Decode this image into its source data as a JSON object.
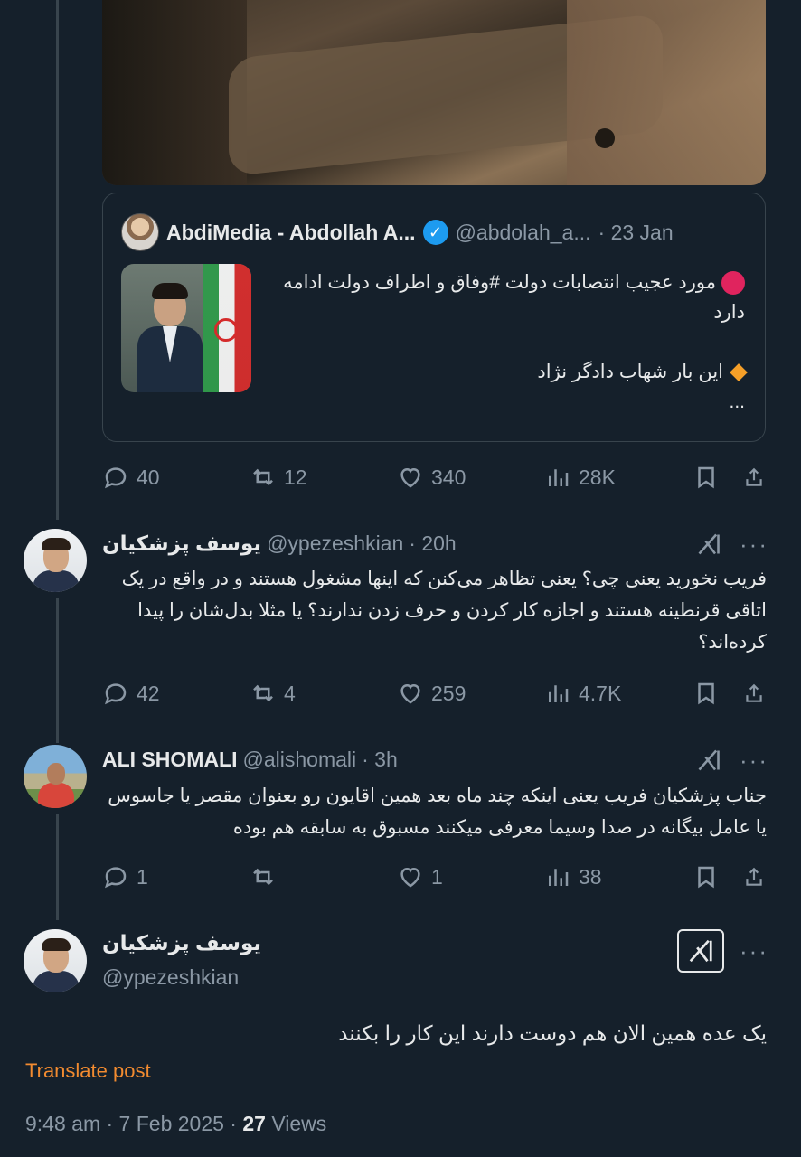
{
  "quoted_post": {
    "author_name": "AbdiMedia - Abdollah A...",
    "author_handle": "@abdolah_a...",
    "date": "· 23 Jan",
    "line1": "مورد عجیب انتصابات دولت #وفاق و اطراف دولت ادامه دارد",
    "line2": "این بار شهاب دادگر نژاد",
    "ellipsis": "..."
  },
  "original_post_stats": {
    "replies": "40",
    "reposts": "12",
    "likes": "340",
    "views": "28K"
  },
  "replies": [
    {
      "author_name": "یوسف پزشکیان",
      "author_handle": "@ypezeshkian",
      "time": "· 20h",
      "text": "فریب نخورید یعنی چی؟ یعنی تظاهر می‌کنن که اینها مشغول هستند و در واقع در یک اتاقی قرنطینه هستند و اجازه کار کردن و حرف زدن ندارند؟ یا مثلا بدل‌شان را پیدا کرده‌اند؟",
      "stats": {
        "replies": "42",
        "reposts": "4",
        "likes": "259",
        "views": "4.7K"
      }
    },
    {
      "author_name": "ALI SHOMALI",
      "author_handle": "@alishomali",
      "time": "· 3h",
      "text": "جناب پزشکیان فریب یعنی اینکه چند ماه بعد همین اقایون رو بعنوان مقصر یا جاسوس یا عامل بیگانه در صدا وسیما معرفی میکنند  مسبوق به سابقه هم بوده",
      "stats": {
        "replies": "1",
        "reposts": "",
        "likes": "1",
        "views": "38"
      }
    }
  ],
  "main_post": {
    "author_name": "یوسف پزشکیان",
    "author_handle": "@ypezeshkian",
    "text": "یک عده همین الان هم دوست دارند این کار را بکنند",
    "translate_label": "Translate post",
    "timestamp": "9:48 am · 7 Feb 2025 · ",
    "views_count": "27",
    "views_label": " Views"
  },
  "icons": {
    "reply": "reply-icon",
    "repost": "repost-icon",
    "like": "heart-icon",
    "views": "views-icon",
    "bookmark": "bookmark-icon",
    "share": "share-icon",
    "grok": "grok-icon",
    "more": "more-icon",
    "verified": "verified-badge-icon"
  },
  "colors": {
    "background": "#15202b",
    "accent_blue": "#1d9bf0",
    "translate": "#f28b30",
    "muted": "#8b98a5"
  }
}
